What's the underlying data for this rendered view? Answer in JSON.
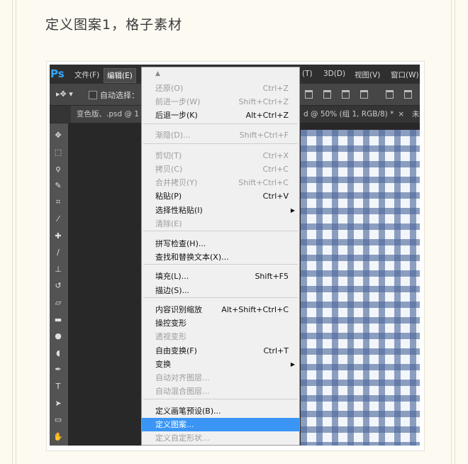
{
  "heading": "定义图案1，格子素材",
  "menubar": {
    "logo": "Ps",
    "items": [
      "文件(F)",
      "编辑(E)"
    ],
    "right_items": [
      "(T)",
      "3D(D)",
      "视图(V)",
      "窗口(W)"
    ]
  },
  "options": {
    "move_glyph": "▸✥ ▾",
    "auto_select": "自动选择："
  },
  "tabs": [
    {
      "label": "变色版、.psd @ 1"
    },
    {
      "label": "d @ 50% (组 1, RGB/8) *",
      "close": "×"
    },
    {
      "label": "未"
    }
  ],
  "menu": {
    "scroll_up": "▲",
    "items": [
      {
        "label": "还原(O)",
        "shortcut": "Ctrl+Z",
        "state": "disabled"
      },
      {
        "label": "前进一步(W)",
        "shortcut": "Shift+Ctrl+Z",
        "state": "disabled"
      },
      {
        "label": "后退一步(K)",
        "shortcut": "Alt+Ctrl+Z",
        "state": "enabled"
      },
      {
        "label": "渐隐(D)...",
        "shortcut": "Shift+Ctrl+F",
        "state": "disabled"
      },
      {
        "label": "剪切(T)",
        "shortcut": "Ctrl+X",
        "state": "disabled"
      },
      {
        "label": "拷贝(C)",
        "shortcut": "Ctrl+C",
        "state": "disabled"
      },
      {
        "label": "合并拷贝(Y)",
        "shortcut": "Shift+Ctrl+C",
        "state": "disabled"
      },
      {
        "label": "粘贴(P)",
        "shortcut": "Ctrl+V",
        "state": "enabled"
      },
      {
        "label": "选择性粘贴(I)",
        "shortcut": "",
        "state": "enabled",
        "submenu": true
      },
      {
        "label": "清除(E)",
        "shortcut": "",
        "state": "disabled"
      },
      {
        "label": "拼写检查(H)...",
        "shortcut": "",
        "state": "enabled"
      },
      {
        "label": "查找和替换文本(X)...",
        "shortcut": "",
        "state": "enabled"
      },
      {
        "label": "填充(L)...",
        "shortcut": "Shift+F5",
        "state": "enabled"
      },
      {
        "label": "描边(S)...",
        "shortcut": "",
        "state": "enabled"
      },
      {
        "label": "内容识别缩放",
        "shortcut": "Alt+Shift+Ctrl+C",
        "state": "enabled"
      },
      {
        "label": "操控变形",
        "shortcut": "",
        "state": "enabled"
      },
      {
        "label": "透视变形",
        "shortcut": "",
        "state": "disabled"
      },
      {
        "label": "自由变换(F)",
        "shortcut": "Ctrl+T",
        "state": "enabled"
      },
      {
        "label": "变换",
        "shortcut": "",
        "state": "enabled",
        "submenu": true
      },
      {
        "label": "自动对齐图层...",
        "shortcut": "",
        "state": "disabled"
      },
      {
        "label": "自动混合图层...",
        "shortcut": "",
        "state": "disabled"
      },
      {
        "label": "定义画笔预设(B)...",
        "shortcut": "",
        "state": "enabled"
      },
      {
        "label": "定义图案...",
        "shortcut": "",
        "state": "highlight"
      },
      {
        "label": "定义自定形状...",
        "shortcut": "",
        "state": "disabled"
      }
    ],
    "submenu_arrow": "▶"
  },
  "tools": [
    {
      "name": "move-tool-icon",
      "glyph": "✥"
    },
    {
      "name": "marquee-tool-icon",
      "glyph": "⬚"
    },
    {
      "name": "lasso-tool-icon",
      "glyph": "ϙ"
    },
    {
      "name": "quick-select-tool-icon",
      "glyph": "✎"
    },
    {
      "name": "crop-tool-icon",
      "glyph": "⌗"
    },
    {
      "name": "eyedropper-tool-icon",
      "glyph": "⁄"
    },
    {
      "name": "healing-brush-tool-icon",
      "glyph": "✚"
    },
    {
      "name": "brush-tool-icon",
      "glyph": "∕"
    },
    {
      "name": "clone-stamp-tool-icon",
      "glyph": "⊥"
    },
    {
      "name": "history-brush-tool-icon",
      "glyph": "↺"
    },
    {
      "name": "eraser-tool-icon",
      "glyph": "▱"
    },
    {
      "name": "gradient-tool-icon",
      "glyph": "▬"
    },
    {
      "name": "blur-tool-icon",
      "glyph": "●"
    },
    {
      "name": "dodge-tool-icon",
      "glyph": "◖"
    },
    {
      "name": "pen-tool-icon",
      "glyph": "✒"
    },
    {
      "name": "type-tool-icon",
      "glyph": "T"
    },
    {
      "name": "path-select-tool-icon",
      "glyph": "➤"
    },
    {
      "name": "rectangle-tool-icon",
      "glyph": "▭"
    },
    {
      "name": "hand-tool-icon",
      "glyph": "✋"
    }
  ]
}
